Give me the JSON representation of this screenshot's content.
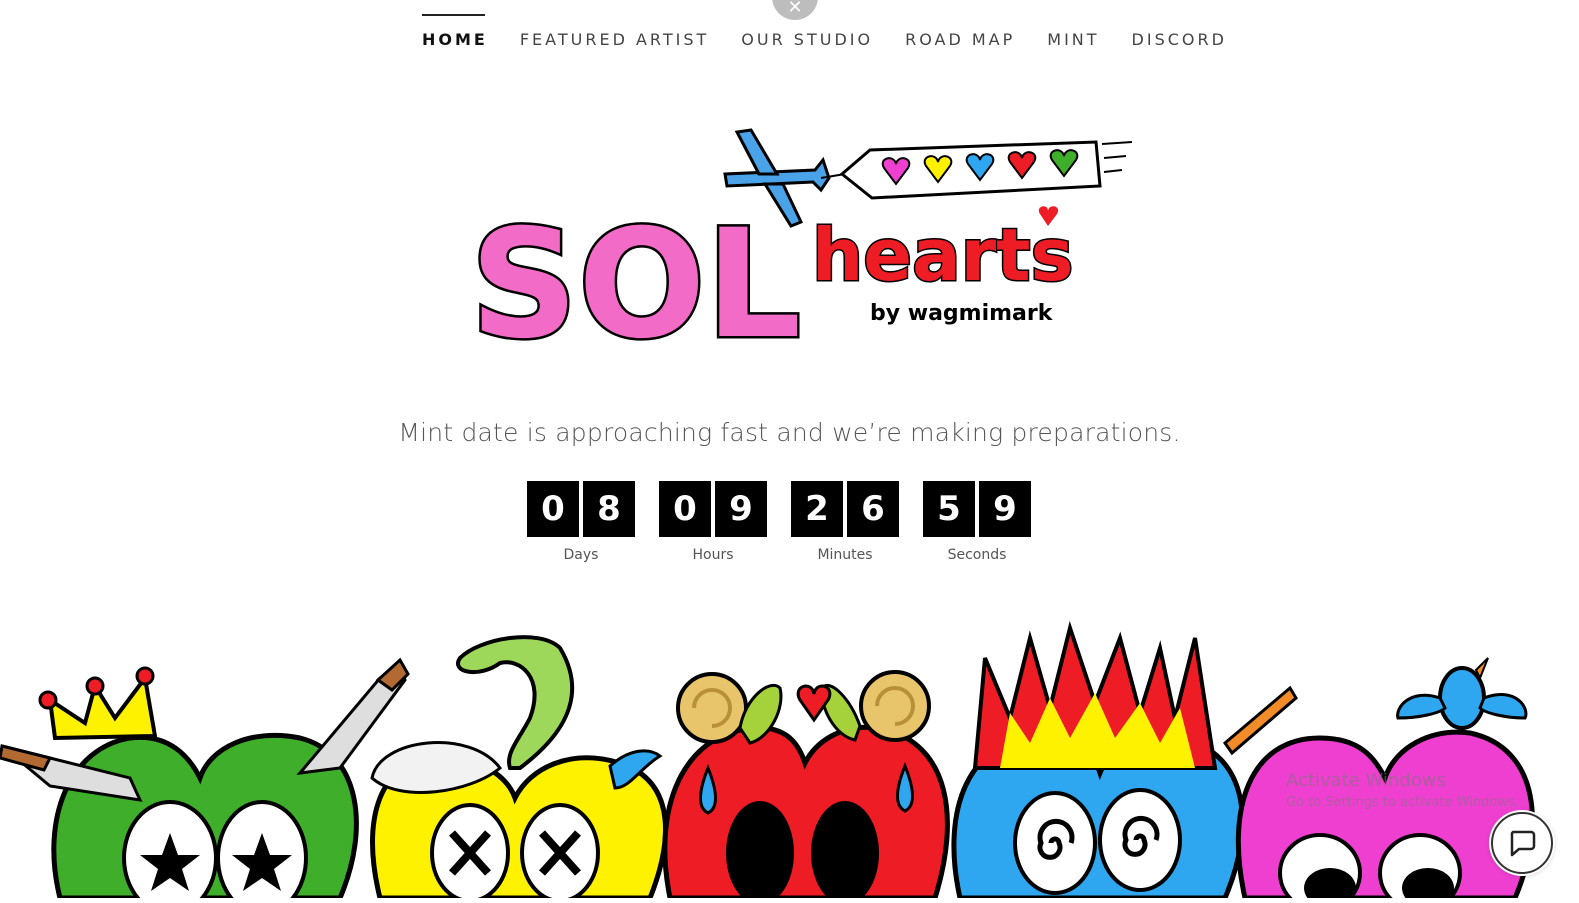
{
  "nav": {
    "items": [
      {
        "label": "HOME",
        "active": true
      },
      {
        "label": "FEATURED ARTIST",
        "active": false
      },
      {
        "label": "OUR STUDIO",
        "active": false
      },
      {
        "label": "ROAD MAP",
        "active": false
      },
      {
        "label": "MINT",
        "active": false
      },
      {
        "label": "DISCORD",
        "active": false
      }
    ]
  },
  "logo": {
    "word_sol": "SOL",
    "word_hearts": "hearts",
    "byline": "by wagmimark"
  },
  "hero": {
    "tagline": "Mint date is approaching fast and we’re making preparations."
  },
  "countdown": {
    "units": [
      {
        "digits": [
          "0",
          "8"
        ],
        "label": "Days"
      },
      {
        "digits": [
          "0",
          "9"
        ],
        "label": "Hours"
      },
      {
        "digits": [
          "2",
          "6"
        ],
        "label": "Minutes"
      },
      {
        "digits": [
          "5",
          "9"
        ],
        "label": "Seconds"
      }
    ]
  },
  "watermark": {
    "title": "Activate Windows",
    "subtitle": "Go to Settings to activate Windows."
  },
  "icons": {
    "close": "close-icon",
    "chat": "chat-bubble-icon"
  },
  "colors": {
    "pink": "#f26bc6",
    "red": "#ee1c24",
    "green": "#3fae2a",
    "yellow": "#fff200",
    "blue": "#2ea7f0",
    "magenta": "#ee3fd0"
  }
}
